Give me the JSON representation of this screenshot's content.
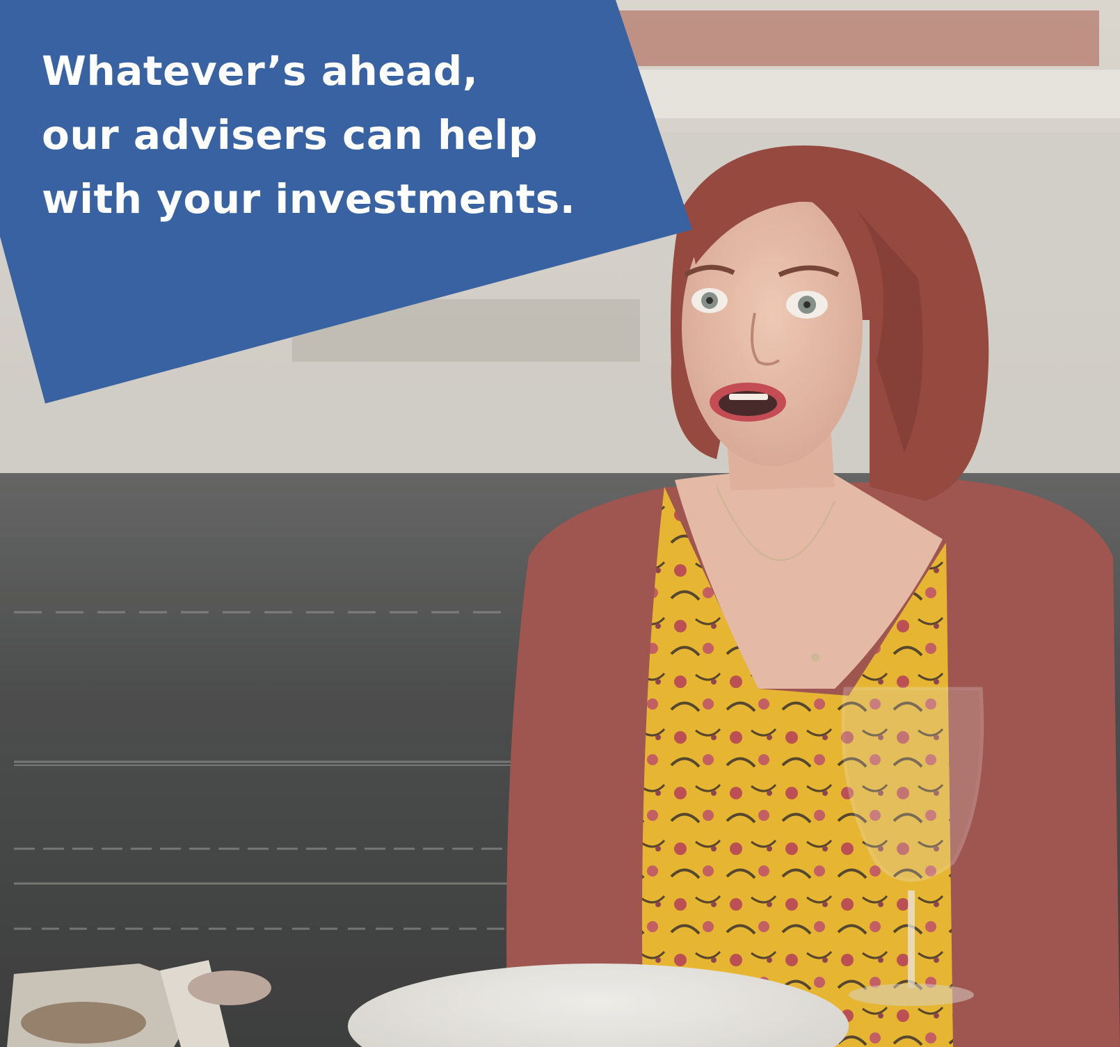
{
  "headline": {
    "lines": [
      "Whatever’s ahead,",
      "our advisers can help",
      "with your investments."
    ]
  },
  "colors": {
    "banner_blue": "#3d67a8",
    "cardigan": "#9a4a46",
    "blouse_yellow": "#e7b326",
    "hair": "#8f3d33",
    "table_dark": "#3f4142"
  },
  "photo": {
    "subject": "woman-surprised-at-dinner-table"
  }
}
